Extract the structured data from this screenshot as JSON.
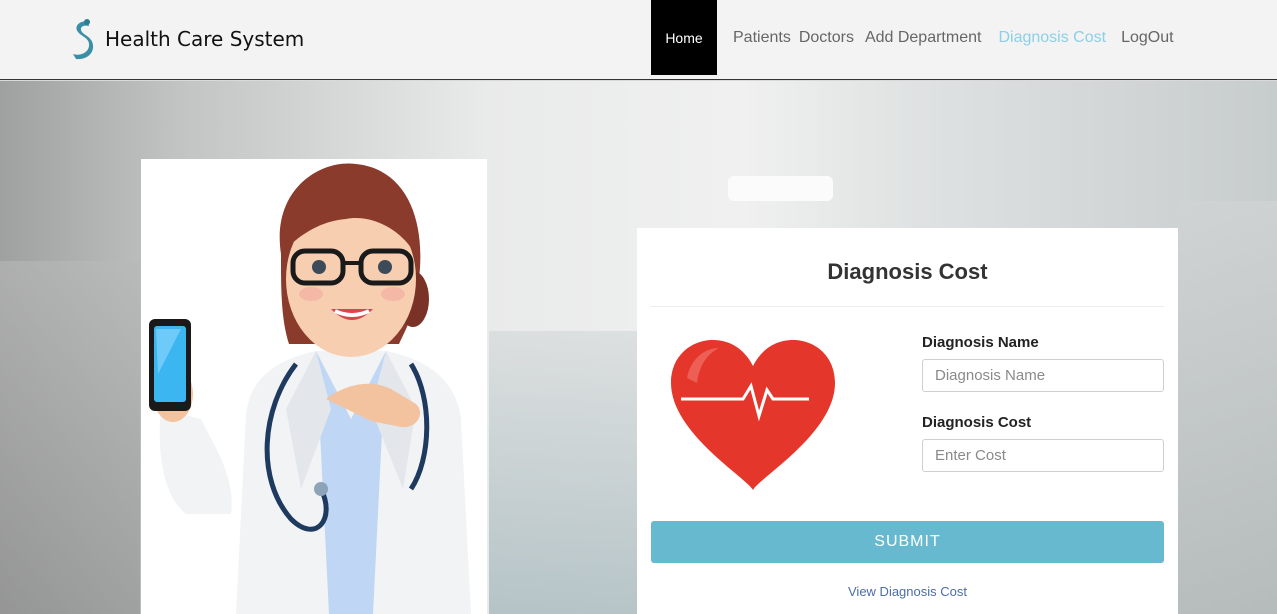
{
  "header": {
    "brand": "Health Care System",
    "nav": {
      "home": "Home",
      "patients": "Patients",
      "doctors": "Doctors",
      "add_department": "Add Department",
      "diagnosis_cost": "Diagnosis Cost",
      "logout": "LogOut"
    },
    "active_link_color": "#8ccfe8"
  },
  "illustrations": {
    "left": "doctor-with-phone-icon",
    "card": "heartbeat-heart-icon"
  },
  "form": {
    "title": "Diagnosis Cost",
    "name_label": "Diagnosis Name",
    "name_placeholder": "Diagnosis Name",
    "name_value": "",
    "cost_label": "Diagnosis Cost",
    "cost_placeholder": "Enter Cost",
    "cost_value": "",
    "submit": "SUBMIT",
    "view_link": "View Diagnosis Cost",
    "submit_color": "#67b9cf"
  }
}
